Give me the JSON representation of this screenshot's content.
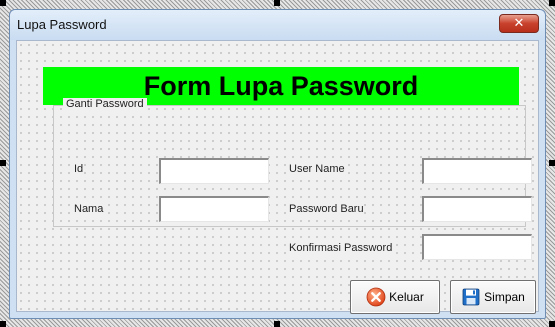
{
  "window": {
    "title": "Lupa Password",
    "close_glyph": "✕"
  },
  "banner": {
    "text": "Form Lupa Password",
    "color": "#00ff00"
  },
  "group": {
    "legend": "Ganti Password"
  },
  "fields": {
    "id": {
      "label": "Id",
      "value": ""
    },
    "nama": {
      "label": "Nama",
      "value": ""
    },
    "user_name": {
      "label": "User Name",
      "value": ""
    },
    "password_baru": {
      "label": "Password Baru",
      "value": ""
    },
    "konfirmasi_password": {
      "label": "Konfirmasi Password",
      "value": ""
    }
  },
  "buttons": {
    "keluar": {
      "label": "Keluar",
      "icon": "exit-icon"
    },
    "simpan": {
      "label": "Simpan",
      "icon": "save-icon"
    }
  }
}
